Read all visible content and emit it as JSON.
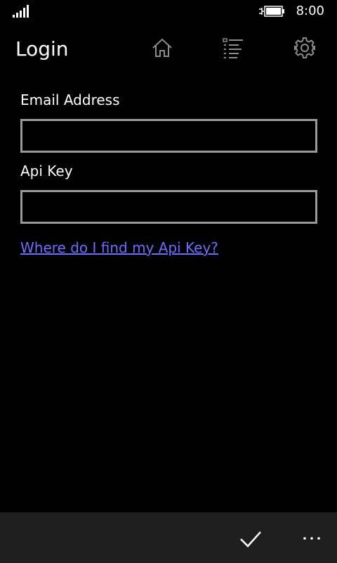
{
  "status_bar": {
    "time": "8:00",
    "signal_icon": "signal-bars-icon",
    "battery_icon": "battery-charging-icon"
  },
  "header": {
    "title": "Login",
    "icons": [
      "home-icon",
      "list-icon",
      "gear-icon"
    ]
  },
  "form": {
    "email_label": "Email Address",
    "email_value": "",
    "api_key_label": "Api Key",
    "api_key_value": "",
    "help_link": "Where do I find my Api Key?"
  },
  "app_bar": {
    "icons": [
      "checkmark-icon",
      "ellipsis-icon"
    ]
  },
  "colors": {
    "background": "#000000",
    "app_bar": "#1f1f1f",
    "link": "#6d6dff",
    "input_border": "#9a9a9a"
  }
}
